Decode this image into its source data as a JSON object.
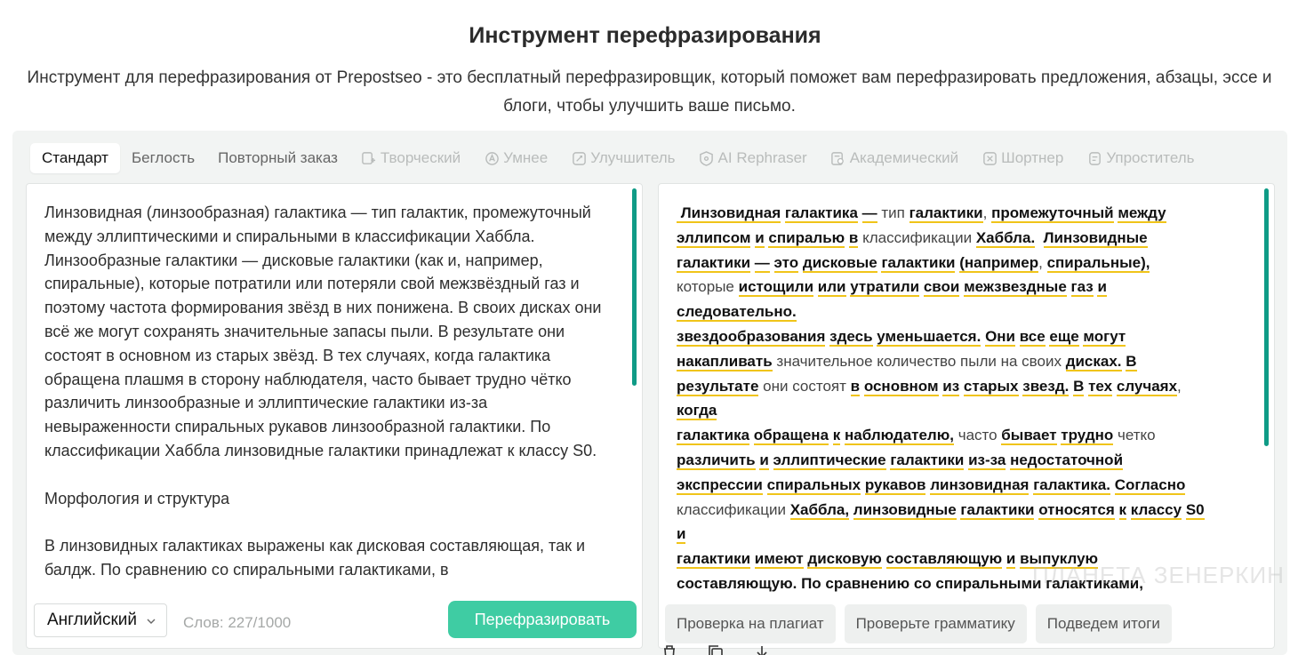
{
  "header": {
    "title": "Инструмент перефразирования",
    "subtitle": "Инструмент для перефразирования от Prepostseo - это бесплатный перефразировщик, который поможет вам перефразировать предложения, абзацы, эссе и блоги, чтобы улучшить ваше письмо."
  },
  "tabs": [
    {
      "label": "Стандарт",
      "icon": "",
      "state": "active"
    },
    {
      "label": "Беглость",
      "icon": "",
      "state": "normal"
    },
    {
      "label": "Повторный заказ",
      "icon": "",
      "state": "normal"
    },
    {
      "label": "Творческий",
      "icon": "creative-icon",
      "state": "locked"
    },
    {
      "label": "Умнее",
      "icon": "smarter-icon",
      "state": "locked"
    },
    {
      "label": "Улучшитель",
      "icon": "improver-icon",
      "state": "locked"
    },
    {
      "label": "AI Rephraser",
      "icon": "ai-icon",
      "state": "locked"
    },
    {
      "label": "Академический",
      "icon": "academic-icon",
      "state": "locked"
    },
    {
      "label": "Шортнер",
      "icon": "shortener-icon",
      "state": "locked"
    },
    {
      "label": "Упроститель",
      "icon": "simplifier-icon",
      "state": "locked"
    }
  ],
  "input": {
    "paragraphs": [
      "Линзовидная (линзообразная) галактика — тип галактик, промежуточный между эллиптическими и спиральными в классификации Хаббла. Линзообразные галактики — дисковые галактики (как и, например, спиральные), которые потратили или потеряли свой межзвёздный газ и поэтому частота формирования звёзд в них понижена. В своих дисках они всё же могут сохранять значительные запасы пыли. В результате они состоят в основном из старых звёзд. В тех случаях, когда галактика обращена плашмя в сторону наблюдателя, часто бывает трудно чётко различить линзообразные и эллиптические галактики из-за невыраженности спиральных рукавов линзообразной галактики. По классификации Хаббла линзовидные галактики принадлежат к классу S0.",
      "Морфология и структура",
      "В линзовидных галактиках выражены как дисковая составляющая, так и балдж. По сравнению со спиральными галактиками, в"
    ],
    "language": "Английский",
    "word_count": "Слов: 227/1000",
    "paraphrase_label": "Перефразировать"
  },
  "output": {
    "lines": [
      [
        [
          "w",
          " Линзовидная"
        ],
        [
          "s",
          " "
        ],
        [
          "w",
          "галактика"
        ],
        [
          "s",
          " "
        ],
        [
          "w",
          "—"
        ],
        [
          "n",
          " тип "
        ],
        [
          "w",
          "галактики"
        ],
        [
          "n",
          ", "
        ],
        [
          "w",
          "промежуточный"
        ],
        [
          "s",
          " "
        ],
        [
          "w",
          "между"
        ]
      ],
      [
        [
          "w",
          "эллипсом"
        ],
        [
          "s",
          " "
        ],
        [
          "w",
          "и"
        ],
        [
          "s",
          " "
        ],
        [
          "w",
          "спиралью"
        ],
        [
          "s",
          " "
        ],
        [
          "w",
          "в"
        ],
        [
          "n",
          " классификации "
        ],
        [
          "w",
          "Хаббла."
        ],
        [
          "s",
          "  "
        ],
        [
          "w",
          "Линзовидные"
        ]
      ],
      [
        [
          "w",
          "галактики"
        ],
        [
          "s",
          " "
        ],
        [
          "w",
          "—"
        ],
        [
          "s",
          " "
        ],
        [
          "w",
          "это"
        ],
        [
          "s",
          " "
        ],
        [
          "w",
          "дисковые"
        ],
        [
          "s",
          " "
        ],
        [
          "w",
          "галактики"
        ],
        [
          "s",
          " "
        ],
        [
          "w",
          "(например"
        ],
        [
          "n",
          ", "
        ],
        [
          "w",
          "спиральные),"
        ]
      ],
      [
        [
          "n",
          "которые "
        ],
        [
          "w",
          "истощили"
        ],
        [
          "s",
          " "
        ],
        [
          "w",
          "или"
        ],
        [
          "s",
          " "
        ],
        [
          "w",
          "утратили"
        ],
        [
          "s",
          " "
        ],
        [
          "w",
          "свои"
        ],
        [
          "s",
          " "
        ],
        [
          "w",
          "межзвездные"
        ],
        [
          "s",
          " "
        ],
        [
          "w",
          "газ"
        ],
        [
          "s",
          " "
        ],
        [
          "w",
          "и"
        ]
      ],
      [
        [
          "w",
          "следовательно."
        ]
      ],
      [
        [
          "w",
          "звездообразования"
        ],
        [
          "s",
          " "
        ],
        [
          "w",
          "здесь"
        ],
        [
          "s",
          " "
        ],
        [
          "w",
          "уменьшается."
        ],
        [
          "s",
          " "
        ],
        [
          "w",
          "Они"
        ],
        [
          "s",
          " "
        ],
        [
          "w",
          "все"
        ],
        [
          "s",
          " "
        ],
        [
          "w",
          "еще"
        ],
        [
          "s",
          " "
        ],
        [
          "w",
          "могут"
        ]
      ],
      [
        [
          "w",
          "накапливать"
        ],
        [
          "n",
          " значительное количество пыли на своих "
        ],
        [
          "w",
          "дисках."
        ],
        [
          "s",
          " "
        ],
        [
          "w",
          "В"
        ]
      ],
      [
        [
          "w",
          "результате"
        ],
        [
          "n",
          " они состоят "
        ],
        [
          "w",
          "в"
        ],
        [
          "s",
          " "
        ],
        [
          "w",
          "основном"
        ],
        [
          "s",
          " "
        ],
        [
          "w",
          "из"
        ],
        [
          "s",
          " "
        ],
        [
          "w",
          "старых"
        ],
        [
          "s",
          " "
        ],
        [
          "w",
          "звезд."
        ],
        [
          "s",
          " "
        ],
        [
          "w",
          "В"
        ],
        [
          "s",
          " "
        ],
        [
          "w",
          "тех"
        ],
        [
          "s",
          " "
        ],
        [
          "w",
          "случаях"
        ],
        [
          "n",
          ","
        ]
      ],
      [
        [
          "w",
          "когда"
        ]
      ],
      [
        [
          "w",
          "галактика"
        ],
        [
          "s",
          " "
        ],
        [
          "w",
          "обращена"
        ],
        [
          "s",
          " "
        ],
        [
          "w",
          "к"
        ],
        [
          "s",
          " "
        ],
        [
          "w",
          "наблюдателю,"
        ],
        [
          "n",
          " часто "
        ],
        [
          "w",
          "бывает"
        ],
        [
          "s",
          " "
        ],
        [
          "w",
          "трудно"
        ],
        [
          "n",
          " четко"
        ]
      ],
      [
        [
          "w",
          "различить"
        ],
        [
          "s",
          " "
        ],
        [
          "w",
          "и"
        ],
        [
          "s",
          " "
        ],
        [
          "w",
          "эллиптические"
        ],
        [
          "s",
          " "
        ],
        [
          "w",
          "галактики"
        ],
        [
          "s",
          " "
        ],
        [
          "w",
          "из-за"
        ],
        [
          "s",
          " "
        ],
        [
          "w",
          "недостаточной"
        ]
      ],
      [
        [
          "w",
          "экспрессии"
        ],
        [
          "s",
          " "
        ],
        [
          "w",
          "спиральных"
        ],
        [
          "s",
          " "
        ],
        [
          "w",
          "рукавов"
        ],
        [
          "s",
          " "
        ],
        [
          "w",
          "линзовидная"
        ],
        [
          "s",
          " "
        ],
        [
          "w",
          "галактика."
        ],
        [
          "s",
          " "
        ],
        [
          "w",
          "Согласно"
        ]
      ],
      [
        [
          "n",
          "классификации "
        ],
        [
          "w",
          "Хаббла,"
        ],
        [
          "s",
          " "
        ],
        [
          "w",
          "линзовидные"
        ],
        [
          "s",
          " "
        ],
        [
          "w",
          "галактики"
        ],
        [
          "s",
          " "
        ],
        [
          "w",
          "относятся"
        ],
        [
          "s",
          " "
        ],
        [
          "w",
          "к"
        ],
        [
          "s",
          " "
        ],
        [
          "w",
          "классу"
        ],
        [
          "s",
          " "
        ],
        [
          "w",
          "S0"
        ]
      ],
      [
        [
          "w",
          "и"
        ]
      ],
      [
        [
          "w",
          "галактики"
        ],
        [
          "s",
          " "
        ],
        [
          "w",
          "имеют"
        ],
        [
          "s",
          " "
        ],
        [
          "w",
          "дисковую"
        ],
        [
          "s",
          " "
        ],
        [
          "w",
          "составляющую"
        ],
        [
          "s",
          " "
        ],
        [
          "w",
          "и"
        ],
        [
          "s",
          " "
        ],
        [
          "w",
          "выпуклую"
        ]
      ],
      [
        [
          "b",
          "составляющую. По сравнению со спиральными галактиками,"
        ]
      ]
    ],
    "watermark": "ПЛАНЕТА ЗЕНЕРКИН",
    "actions": [
      "Проверка на плагиат",
      "Проверьте грамматику",
      "Подведем итоги"
    ]
  },
  "colors": {
    "accent": "#3fcca3",
    "scroll": "#0f9b86",
    "highlight_underline": "#f0c419"
  }
}
